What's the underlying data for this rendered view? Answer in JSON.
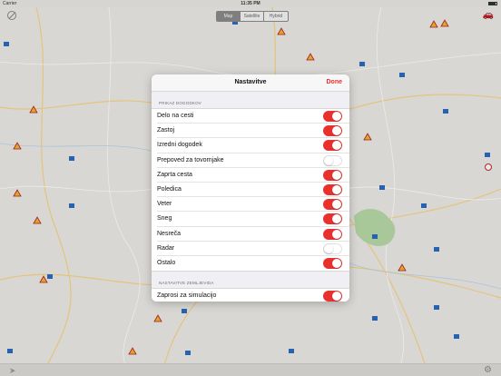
{
  "status_bar": {
    "carrier": "Carrier",
    "time": "11:35 PM"
  },
  "map_mode": {
    "options": [
      "Map",
      "Satellite",
      "Hybrid"
    ],
    "selected": "Map"
  },
  "icons": {
    "location": "location-off-icon",
    "layers": "car-icon",
    "navigate": "navigation-arrow-icon",
    "settings": "gear-icon"
  },
  "accent_color": "#e8312f",
  "settings": {
    "title": "Nastavitve",
    "done_label": "Done",
    "sections": [
      {
        "header": "PRIKAZ DOGODKOV",
        "items": [
          {
            "label": "Delo na cesti",
            "on": true
          },
          {
            "label": "Zastoj",
            "on": true
          },
          {
            "label": "Izredni dogodek",
            "on": true
          },
          {
            "label": "Prepoved za tovornjake",
            "on": false
          },
          {
            "label": "Zaprta cesta",
            "on": true
          },
          {
            "label": "Poledica",
            "on": true
          },
          {
            "label": "Veter",
            "on": true
          },
          {
            "label": "Sneg",
            "on": true
          },
          {
            "label": "Nesreča",
            "on": true
          },
          {
            "label": "Radar",
            "on": false
          },
          {
            "label": "Ostalo",
            "on": true
          }
        ]
      },
      {
        "header": "NASTAVITVE ZEMLJEVIDA",
        "items": [
          {
            "label": "Zaprosi za simulacijo",
            "on": true
          }
        ]
      }
    ]
  }
}
